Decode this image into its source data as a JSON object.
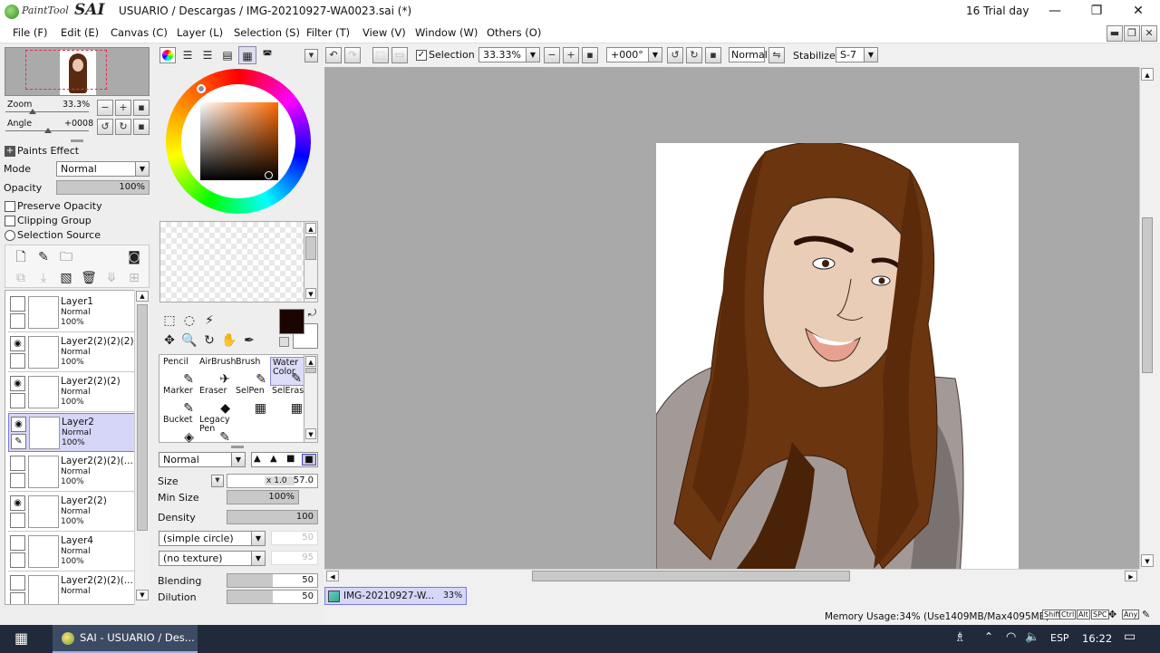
{
  "app": {
    "logo_text": "PaintTool",
    "logo_brand": "SAI",
    "title": "USUARIO / Descargas / IMG-20210927-WA0023.sai (*)",
    "trial": "16 Trial day"
  },
  "menu": [
    "File (F)",
    "Edit (E)",
    "Canvas (C)",
    "Layer (L)",
    "Selection (S)",
    "Filter (T)",
    "View (V)",
    "Window (W)",
    "Others (O)"
  ],
  "navigator": {
    "zoom_label": "Zoom",
    "zoom_value": "33.3%",
    "angle_label": "Angle",
    "angle_value": "+0008"
  },
  "layer_props": {
    "paints_effect": "Paints Effect",
    "mode_label": "Mode",
    "mode_value": "Normal",
    "opacity_label": "Opacity",
    "opacity_value": "100%",
    "opacity_fraction": 1.0,
    "preserve_opacity": "Preserve Opacity",
    "clipping_group": "Clipping Group",
    "selection_source": "Selection Source"
  },
  "layers": [
    {
      "name": "Layer1",
      "mode": "Normal",
      "opacity": "100%",
      "visible": false,
      "active": false
    },
    {
      "name": "Layer2(2)(2)(2)",
      "mode": "Normal",
      "opacity": "100%",
      "visible": true,
      "active": false
    },
    {
      "name": "Layer2(2)(2)",
      "mode": "Normal",
      "opacity": "100%",
      "visible": true,
      "active": false
    },
    {
      "name": "Layer2",
      "mode": "Normal",
      "opacity": "100%",
      "visible": true,
      "active": true
    },
    {
      "name": "Layer2(2)(2)(...",
      "mode": "Normal",
      "opacity": "100%",
      "visible": false,
      "active": false
    },
    {
      "name": "Layer2(2)",
      "mode": "Normal",
      "opacity": "100%",
      "visible": true,
      "active": false
    },
    {
      "name": "Layer4",
      "mode": "Normal",
      "opacity": "100%",
      "visible": false,
      "active": false
    },
    {
      "name": "Layer2(2)(2)(...",
      "mode": "Normal",
      "opacity": "",
      "visible": false,
      "active": false
    }
  ],
  "tools": [
    {
      "label": "Pencil",
      "glyph": "✎"
    },
    {
      "label": "AirBrush",
      "glyph": "✈"
    },
    {
      "label": "Brush",
      "glyph": "✎"
    },
    {
      "label": "Water Color",
      "glyph": "✎"
    },
    {
      "label": "Marker",
      "glyph": "✎"
    },
    {
      "label": "Eraser",
      "glyph": "◆"
    },
    {
      "label": "SelPen",
      "glyph": "▦"
    },
    {
      "label": "SelEras",
      "glyph": "▦"
    },
    {
      "label": "Bucket",
      "glyph": "◈"
    },
    {
      "label": "Legacy Pen",
      "glyph": "✎"
    }
  ],
  "brush": {
    "blend_mode": "Normal",
    "size_label": "Size",
    "size_mult": "x 1.0",
    "size_value": "57.0",
    "min_size_label": "Min Size",
    "min_size_value": "100%",
    "min_size_fraction": 1.0,
    "density_label": "Density",
    "density_value": "100",
    "density_fraction": 1.0,
    "shape": "(simple circle)",
    "shape_value": "50",
    "texture": "(no texture)",
    "texture_value": "95",
    "blending_label": "Blending",
    "blending_value": "50",
    "blending_fraction": 0.5,
    "dilution_label": "Dilution",
    "dilution_value": "50",
    "dilution_fraction": 0.5
  },
  "toolbar": {
    "selection_label": "Selection",
    "zoom": "33.33%",
    "angle": "+000°",
    "blend": "Normal",
    "stabilizer_label": "Stabilizer",
    "stabilizer_value": "S-7"
  },
  "canvas_tab": {
    "name": "IMG-20210927-W...",
    "zoom": "33%"
  },
  "status": {
    "memory": "Memory Usage:34% (Use1409MB/Max4095MB)",
    "keys": [
      "Shift",
      "Ctrl",
      "Alt",
      "SPC",
      "Any"
    ]
  },
  "taskbar": {
    "app_label": "SAI - USUARIO / Des...",
    "lang": "ESP",
    "time": "16:22"
  },
  "colors": {
    "primary": "#1a0500",
    "accent_active": "#d6d6f8"
  }
}
